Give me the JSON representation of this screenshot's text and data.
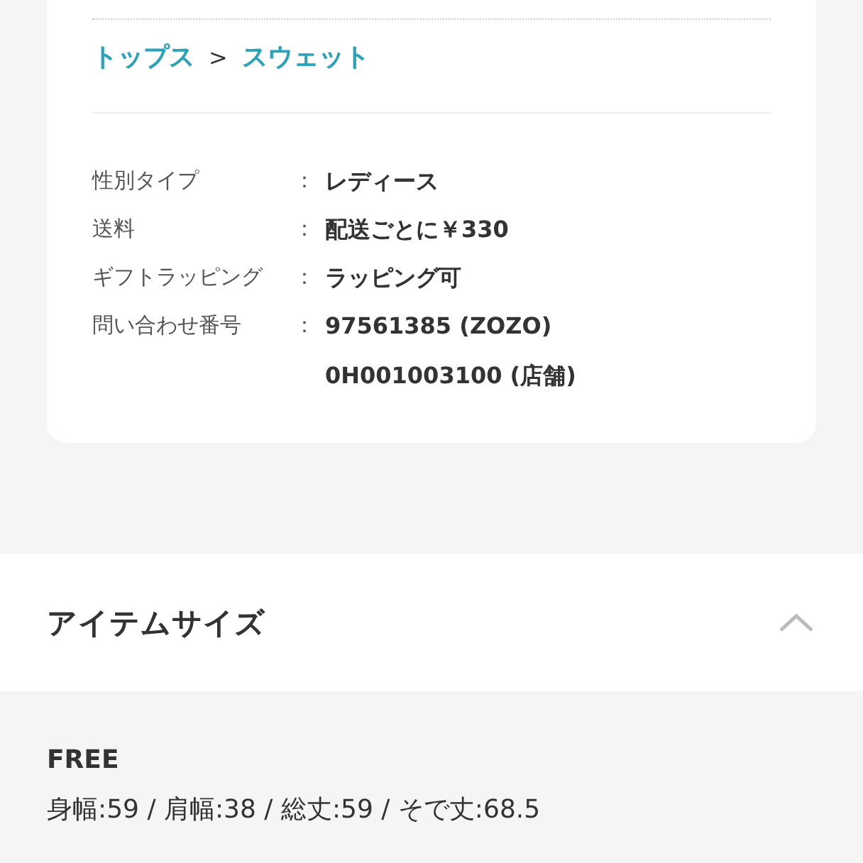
{
  "breadcrumb": {
    "items": [
      "トップス",
      "スウェット"
    ],
    "separator": ">"
  },
  "details": [
    {
      "label": "性別タイプ",
      "separator": "：",
      "values": [
        "レディース"
      ]
    },
    {
      "label": "送料",
      "separator": "：",
      "values": [
        "配送ごとに￥330"
      ]
    },
    {
      "label": "ギフトラッピング",
      "separator": "：",
      "values": [
        "ラッピング可"
      ]
    },
    {
      "label": "問い合わせ番号",
      "separator": "：",
      "values": [
        "97561385 (ZOZO)",
        "0H001003100 (店舗)"
      ]
    }
  ],
  "size_section": {
    "title": "アイテムサイズ",
    "expanded": true,
    "sizes": [
      {
        "name": "FREE",
        "measurements": "身幅:59 / 肩幅:38 / 総丈:59 / そで丈:68.5"
      }
    ]
  }
}
